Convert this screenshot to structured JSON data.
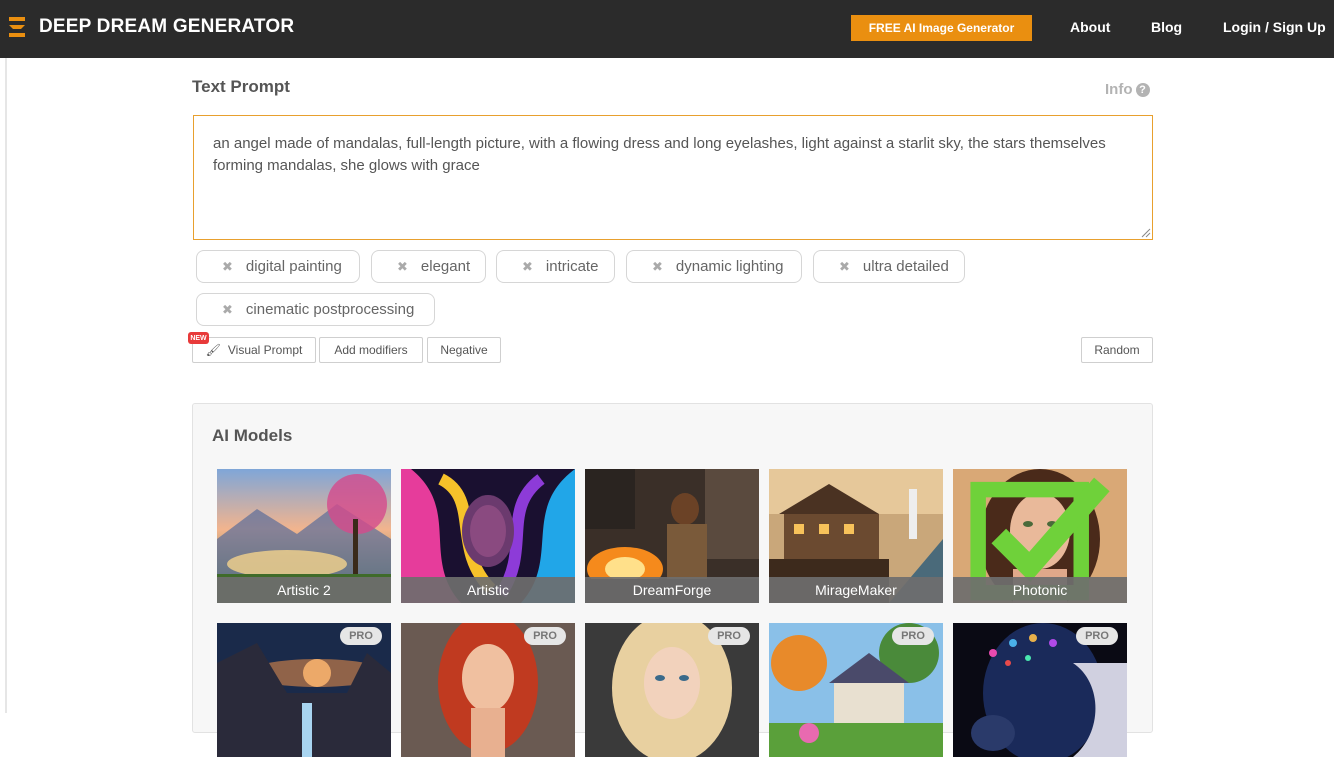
{
  "header": {
    "logo_text": "DEEP DREAM GENERATOR",
    "free_button": "FREE AI Image Generator",
    "nav": [
      "About",
      "Blog",
      "Login / Sign Up"
    ]
  },
  "prompt": {
    "title": "Text Prompt",
    "info": "Info",
    "text": "an angel made of mandalas, full-length picture, with a flowing dress and long eyelashes, light against a starlit sky, the stars themselves forming mandalas, she glows with grace",
    "tags": [
      "digital painting",
      "elegant",
      "intricate",
      "dynamic lighting",
      "ultra detailed",
      "cinematic postprocessing"
    ],
    "new_badge": "NEW",
    "buttons": {
      "visual_prompt": "Visual Prompt",
      "add_modifiers": "Add modifiers",
      "negative": "Negative",
      "random": "Random"
    }
  },
  "models": {
    "title": "AI Models",
    "row1": [
      {
        "label": "Artistic 2",
        "selected": false
      },
      {
        "label": "Artistic",
        "selected": false
      },
      {
        "label": "DreamForge",
        "selected": false
      },
      {
        "label": "MirageMaker",
        "selected": false
      },
      {
        "label": "Photonic",
        "selected": true
      }
    ],
    "row2_badge": "PRO"
  },
  "colors": {
    "topbar": "#2b2b2b",
    "accent": "#ea8f10",
    "prompt_border": "#e8a02e",
    "check": "#6fd13a"
  }
}
